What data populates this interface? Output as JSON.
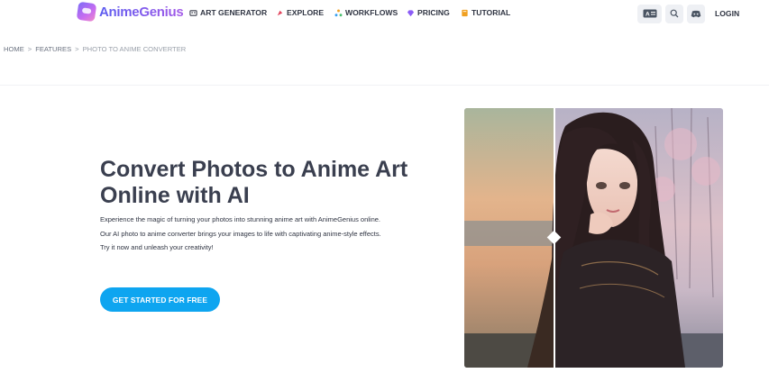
{
  "brand": {
    "name": "AnimeGenius"
  },
  "nav": {
    "items": [
      {
        "label": "ART GENERATOR",
        "icon": "palette-icon"
      },
      {
        "label": "EXPLORE",
        "icon": "compass-icon"
      },
      {
        "label": "WORKFLOWS",
        "icon": "workflow-icon"
      },
      {
        "label": "PRICING",
        "icon": "diamond-icon"
      },
      {
        "label": "TUTORIAL",
        "icon": "book-icon"
      }
    ],
    "login": "LOGIN"
  },
  "breadcrumb": {
    "items": [
      "HOME",
      "FEATURES",
      "PHOTO TO ANIME CONVERTER"
    ],
    "separator": ">"
  },
  "hero": {
    "title_line1": "Convert Photos to Anime Art",
    "title_line2": "Online with AI",
    "desc_line1": "Experience the magic of turning your photos into stunning anime art with AnimeGenius online.",
    "desc_line2": "Our AI photo to anime converter brings your images to life with captivating anime-style effects.",
    "desc_line3": "Try it now and unleash your creativity!",
    "cta_label": "GET STARTED FOR FREE"
  },
  "colors": {
    "accent": "#0ea5f0",
    "text": "#2f3442",
    "brand_gradient_start": "#5b5cf0",
    "brand_gradient_end": "#a35ae8"
  }
}
